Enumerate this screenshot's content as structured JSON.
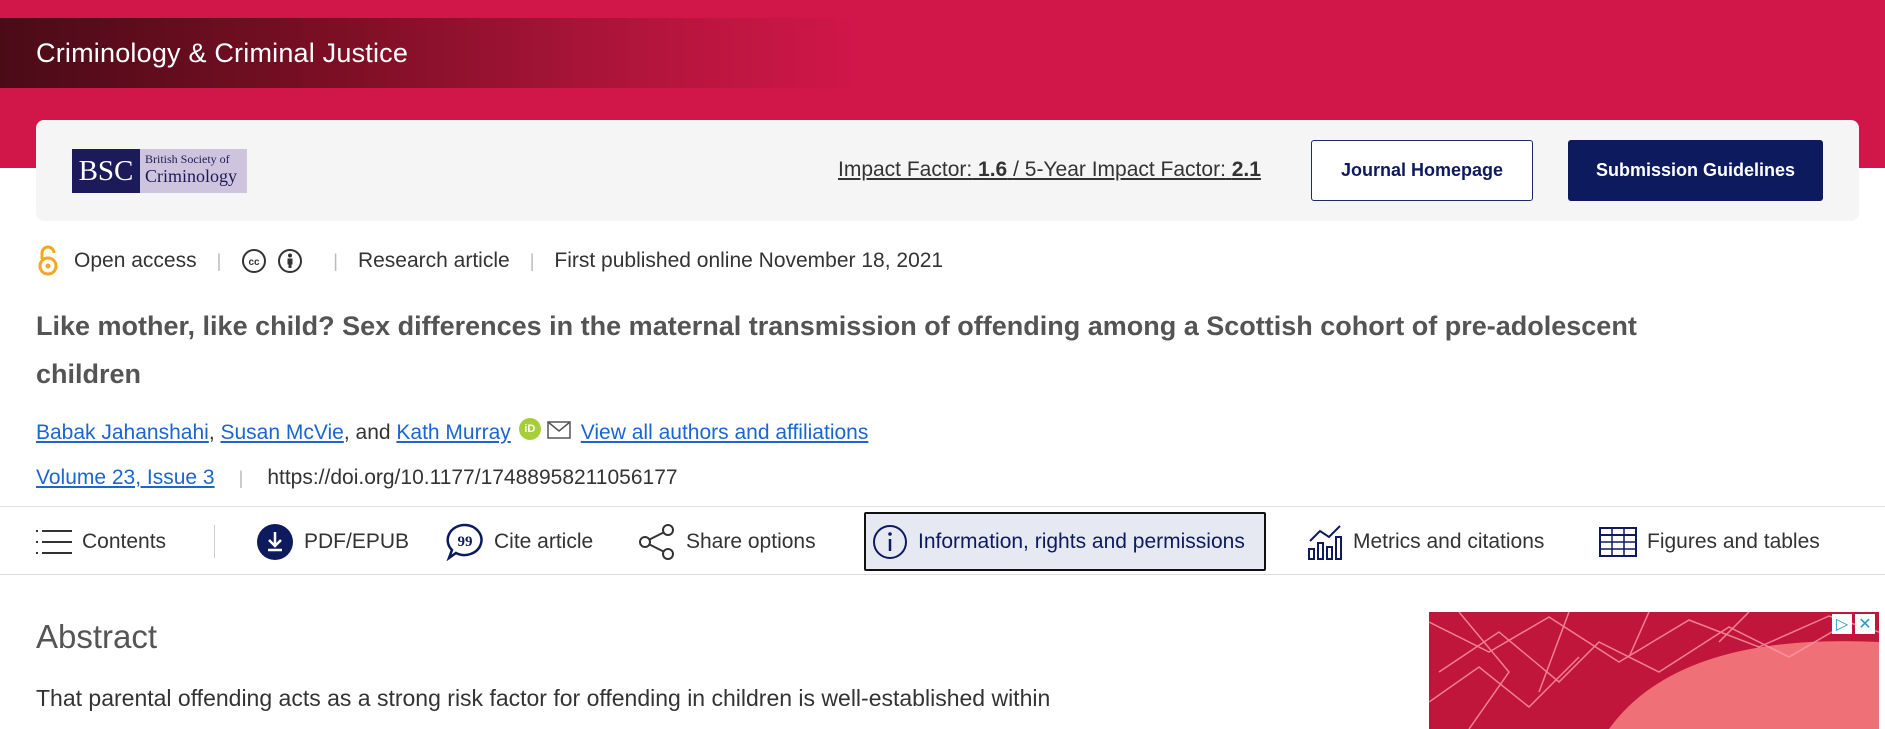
{
  "journal": {
    "name": "Criminology & Criminal Justice",
    "logo_abbr": "BSC",
    "logo_line1": "British Society of",
    "logo_line2": "Criminology",
    "impact_label": "Impact Factor:",
    "impact_value": "1.6",
    "five_year_label": "/ 5-Year Impact Factor:",
    "five_year_value": "2.1",
    "homepage_button": "Journal Homepage",
    "guidelines_button": "Submission Guidelines"
  },
  "article_meta": {
    "access": "Open access",
    "type": "Research article",
    "published": "First published online November 18, 2021"
  },
  "article": {
    "title": "Like mother, like child? Sex differences in the maternal transmission of offending among a Scottish cohort of pre-adolescent children",
    "authors": [
      {
        "name": "Babak Jahanshahi"
      },
      {
        "name": "Susan McVie"
      },
      {
        "name": "Kath Murray"
      }
    ],
    "author_sep1": ", ",
    "author_sep2": ", and ",
    "orcid_label": "iD",
    "all_authors_link": "View all authors and affiliations",
    "volume_issue": "Volume 23, Issue 3",
    "doi": "https://doi.org/10.1177/17488958211056177"
  },
  "toolbar": {
    "contents": "Contents",
    "pdf": "PDF/EPUB",
    "cite": "Cite article",
    "share": "Share options",
    "info": "Information, rights and permissions",
    "metrics": "Metrics and citations",
    "figures": "Figures and tables"
  },
  "abstract": {
    "heading": "Abstract",
    "first_line": "That parental offending acts as a strong risk factor for offending in children is well-established within"
  },
  "colors": {
    "brand_red": "#d1164a",
    "navy": "#0d1b5e",
    "link": "#1a66d1",
    "oa_orange": "#f5a623",
    "orcid_green": "#a6ce39"
  }
}
